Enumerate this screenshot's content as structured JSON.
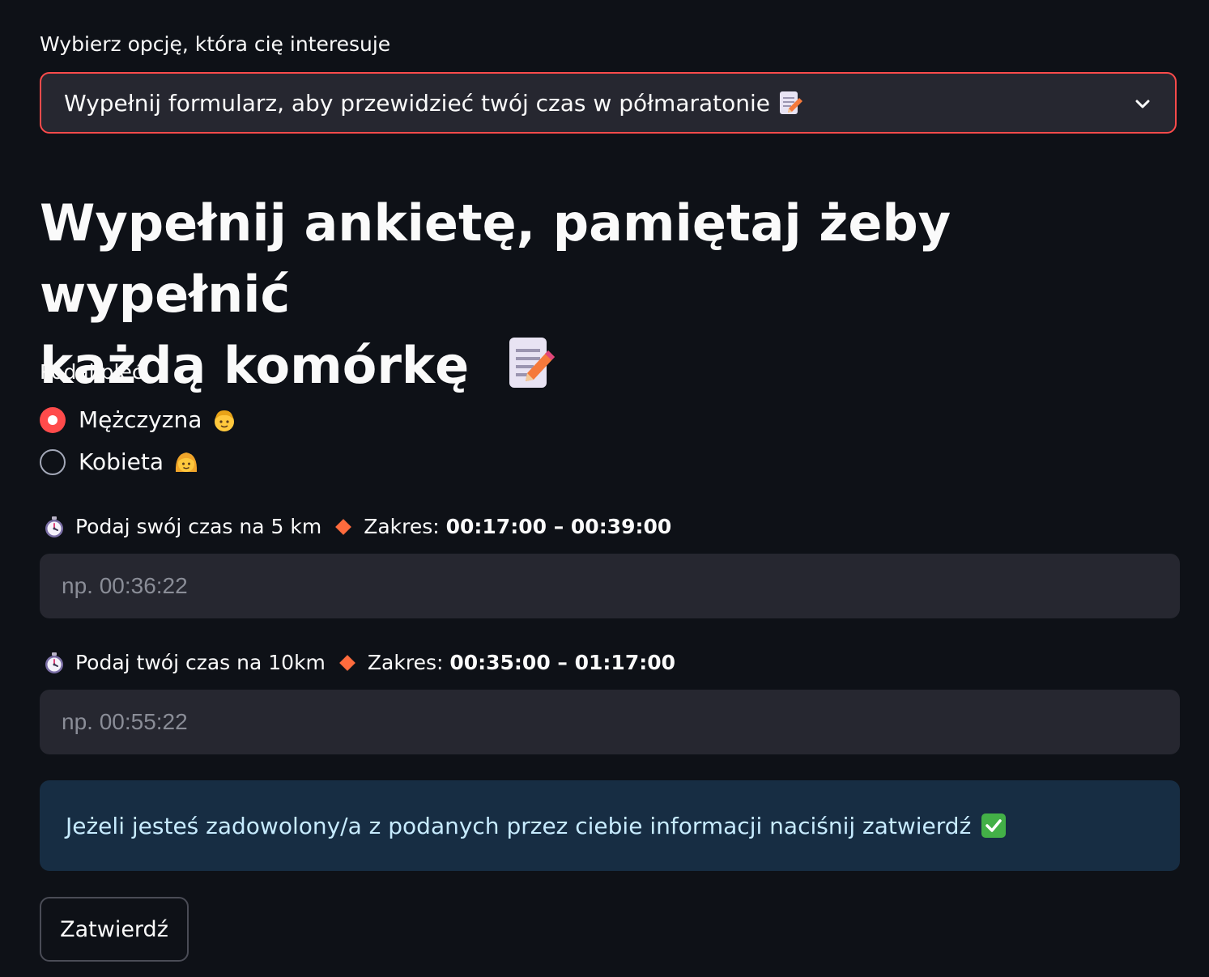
{
  "select": {
    "label": "Wybierz opcję, która cię interesuje",
    "value": "Wypełnij formularz, aby przewidzieć twój czas w półmaratonie",
    "icon": "memo-icon"
  },
  "title": {
    "line1": "Wypełnij ankietę, pamiętaj żeby wypełnić",
    "line2": "każdą komórkę"
  },
  "gender": {
    "label": "Podaj płeć",
    "options": [
      {
        "label": "Mężczyzna",
        "selected": true,
        "icon": "man-face-icon"
      },
      {
        "label": "Kobieta",
        "selected": false,
        "icon": "woman-face-icon"
      }
    ]
  },
  "fields": [
    {
      "label": "Podaj swój czas na 5 km",
      "range_prefix": "Zakres:",
      "range_value": "00:17:00 – 00:39:00",
      "placeholder": "np. 00:36:22",
      "value": ""
    },
    {
      "label": "Podaj twój czas na 10km",
      "range_prefix": "Zakres:",
      "range_value": "00:35:00 – 01:17:00",
      "placeholder": "np. 00:55:22",
      "value": ""
    }
  ],
  "info": {
    "text": "Jeżeli jesteś zadowolony/a z podanych przez ciebie informacji naciśnij zatwierdź",
    "icon": "check-mark-icon"
  },
  "submit": {
    "label": "Zatwierdź"
  },
  "colors": {
    "background": "#0e1117",
    "accent": "#ff4b4b",
    "input_bg": "#262730",
    "info_bg": "#172d43",
    "info_text": "#c7ebff",
    "diamond": "#ff6b3d"
  }
}
